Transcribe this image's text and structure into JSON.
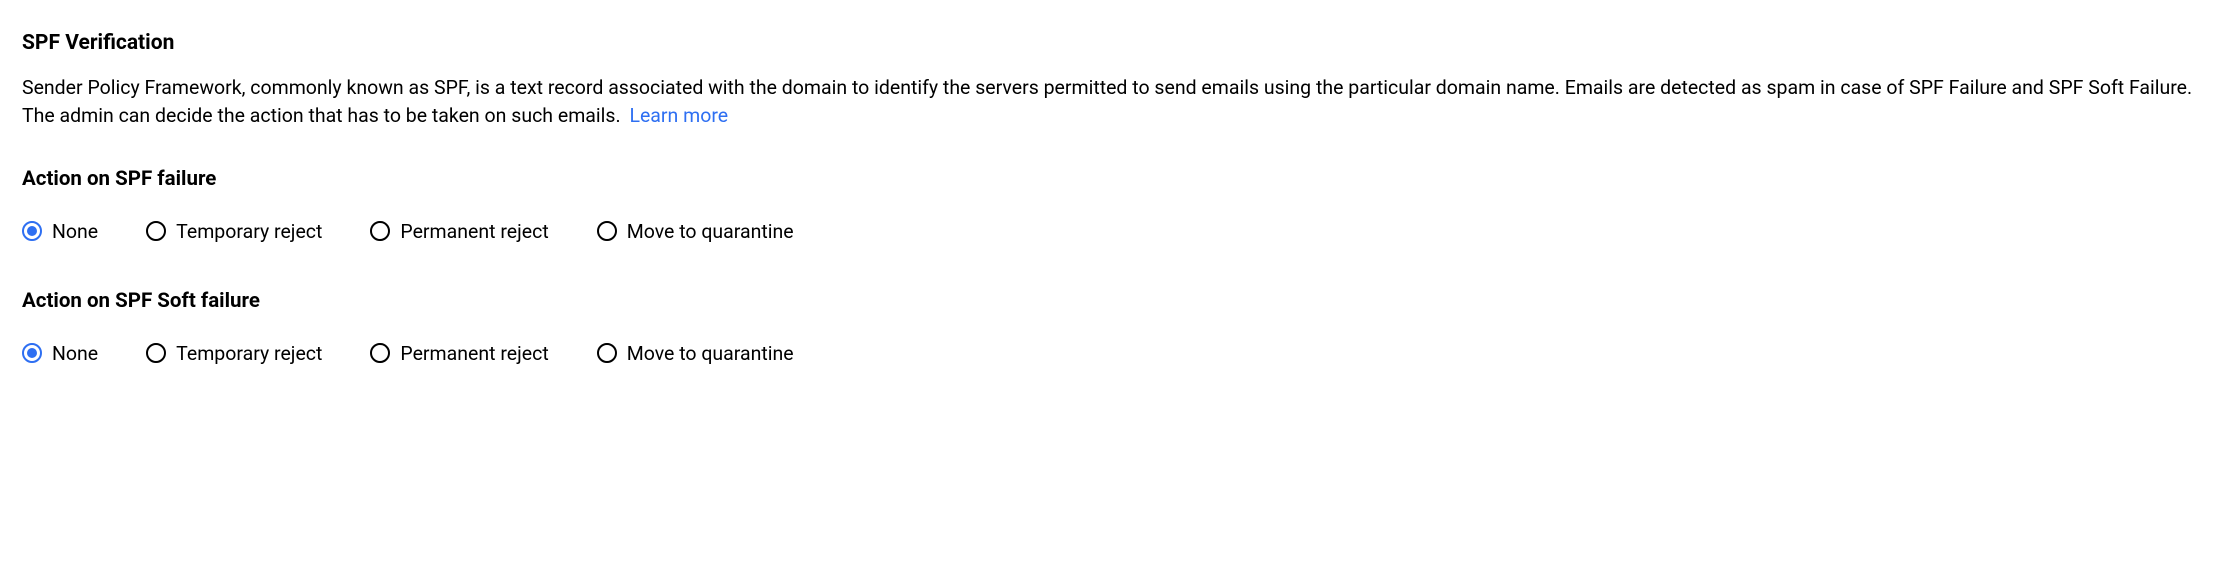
{
  "colors": {
    "accent": "#2e6ff2",
    "text": "#000000"
  },
  "section": {
    "title": "SPF Verification",
    "description": "Sender Policy Framework, commonly known as SPF, is a text record associated with the domain to identify the servers permitted to send emails using the particular domain name. Emails are detected as spam in case of SPF Failure and SPF Soft Failure. The admin can decide the action that has to be taken on such emails.",
    "learn_more": "Learn more"
  },
  "groups": [
    {
      "title": "Action on SPF failure",
      "selected_index": 0,
      "options": [
        "None",
        "Temporary reject",
        "Permanent reject",
        "Move to quarantine"
      ]
    },
    {
      "title": "Action on SPF Soft failure",
      "selected_index": 0,
      "options": [
        "None",
        "Temporary reject",
        "Permanent reject",
        "Move to quarantine"
      ]
    }
  ]
}
